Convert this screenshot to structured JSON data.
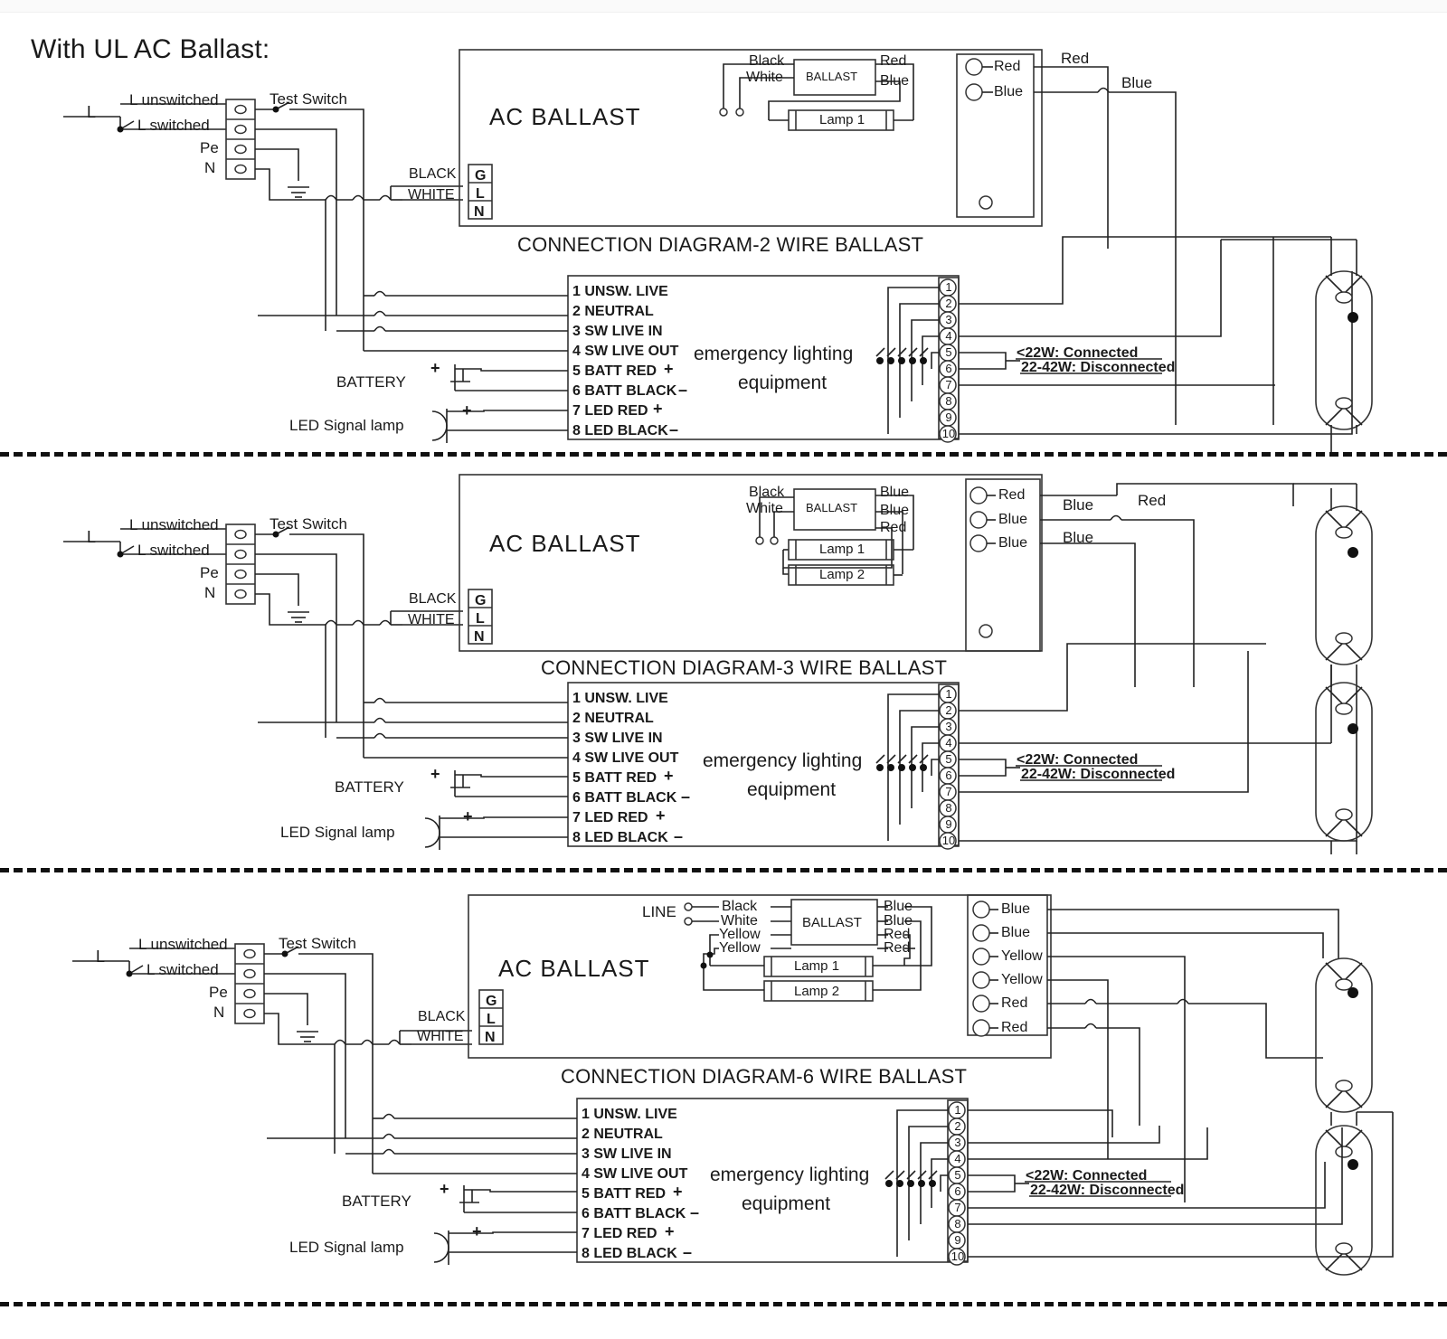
{
  "page": {
    "title": "With UL AC Ballast:"
  },
  "common": {
    "line_label": "L",
    "terminal_labels": [
      "L  unswitched",
      "L  switched",
      "Pe",
      "N"
    ],
    "test_switch": "Test Switch",
    "black": "BLACK",
    "white": "WHITE",
    "gln": [
      "G",
      "L",
      "N"
    ],
    "ac_ballast": "AC BALLAST",
    "ballast_box": "BALLAST",
    "battery": "BATTERY",
    "led_signal_lamp": "LED Signal lamp",
    "plus": "+",
    "minus": "–",
    "emergency_line1": "emergency lighting",
    "emergency_line2": "equipment",
    "note_connected": "<22W: Connected",
    "note_disconnected": "22-42W: Disconnected",
    "terminal_list": [
      "1 UNSW. LIVE",
      "2 NEUTRAL",
      "3 SW LIVE IN",
      "4 SW LIVE OUT",
      "5 BATT RED",
      "6 BATT BLACK",
      "7 LED RED",
      "8 LED BLACK"
    ],
    "terminal_signs": [
      "",
      "",
      "",
      "",
      "+",
      "–",
      "+",
      "–"
    ],
    "connector_numbers": [
      "1",
      "2",
      "3",
      "4",
      "5",
      "6",
      "7",
      "8",
      "9",
      "10"
    ],
    "line_terminal": "LINE"
  },
  "diagram1": {
    "caption": "CONNECTION DIAGRAM-2 WIRE BALLAST",
    "ballast_inputs": [
      "Black",
      "White"
    ],
    "ballast_outputs": [
      "Red",
      "Blue"
    ],
    "lamps": [
      "Lamp 1"
    ],
    "connector_wires": [
      "Red",
      "Blue"
    ],
    "external_wire_labels": [
      "Red",
      "Blue"
    ]
  },
  "diagram2": {
    "caption": "CONNECTION DIAGRAM-3 WIRE BALLAST",
    "ballast_inputs": [
      "Black",
      "White"
    ],
    "ballast_outputs": [
      "Blue",
      "Blue",
      "Red"
    ],
    "lamps": [
      "Lamp 1",
      "Lamp 2"
    ],
    "connector_wires": [
      "Red",
      "Blue",
      "Blue"
    ],
    "external_wire_labels": [
      "Blue",
      "Red",
      "Blue"
    ]
  },
  "diagram3": {
    "caption": "CONNECTION DIAGRAM-6 WIRE BALLAST",
    "ballast_inputs": [
      "Black",
      "White",
      "Yellow",
      "Yellow"
    ],
    "ballast_outputs": [
      "Blue",
      "Blue",
      "Red",
      "Red"
    ],
    "lamps": [
      "Lamp 1",
      "Lamp 2"
    ],
    "connector_wires": [
      "Blue",
      "Blue",
      "Yellow",
      "Yellow",
      "Red",
      "Red"
    ],
    "external_wire_labels": []
  }
}
